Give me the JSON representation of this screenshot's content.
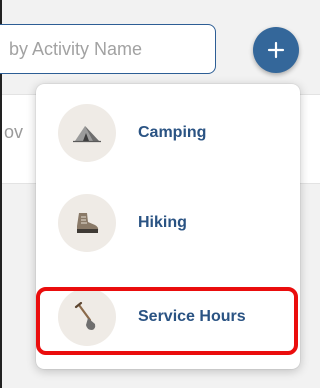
{
  "search": {
    "placeholder": "by Activity Name"
  },
  "background": {
    "partial_text": "ov"
  },
  "toolbar": {
    "add_symbol": "+"
  },
  "menu": {
    "items": [
      {
        "label": "Camping",
        "icon": "tent-icon"
      },
      {
        "label": "Hiking",
        "icon": "hiking-boot-icon"
      },
      {
        "label": "Service Hours",
        "icon": "shovel-icon"
      }
    ]
  },
  "colors": {
    "accent": "#34679a",
    "link_text": "#2a5383",
    "icon_bg": "#efebe6",
    "highlight": "#ea0d0d"
  }
}
